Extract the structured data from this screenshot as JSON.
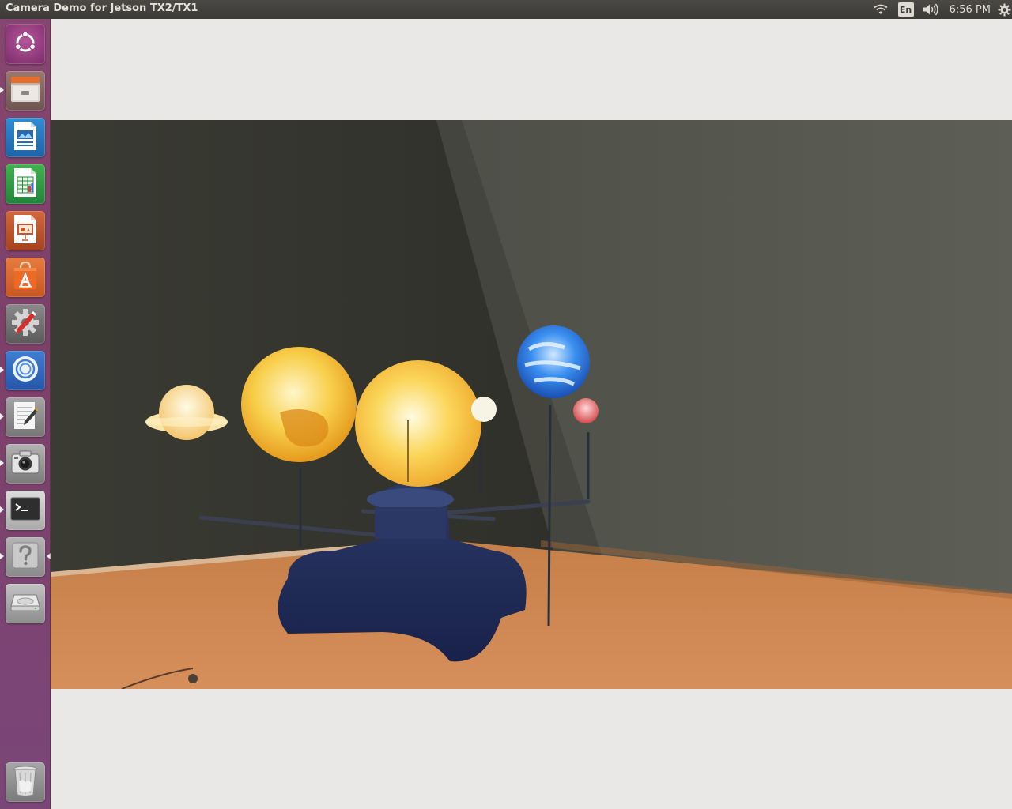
{
  "window": {
    "title": "Camera Demo for Jetson TX2/TX1"
  },
  "indicators": {
    "network_icon": "wifi-icon",
    "keyboard_layout": "En",
    "volume_icon": "speaker-icon",
    "clock": "6:56 PM",
    "system_icon": "gear-icon"
  },
  "launcher": {
    "items": [
      {
        "name": "ubuntu-dash",
        "icon": "ubuntu-logo-icon"
      },
      {
        "name": "files",
        "icon": "file-cabinet-icon"
      },
      {
        "name": "libreoffice-writer",
        "icon": "writer-document-icon"
      },
      {
        "name": "libreoffice-calc",
        "icon": "calc-spreadsheet-icon"
      },
      {
        "name": "libreoffice-impress",
        "icon": "impress-presentation-icon"
      },
      {
        "name": "ubuntu-software",
        "icon": "shopping-bag-icon"
      },
      {
        "name": "system-settings",
        "icon": "settings-wrench-icon"
      },
      {
        "name": "chromium",
        "icon": "chromium-icon"
      },
      {
        "name": "text-editor",
        "icon": "text-editor-icon"
      },
      {
        "name": "camera-demo",
        "icon": "camera-icon"
      },
      {
        "name": "terminal",
        "icon": "terminal-icon"
      },
      {
        "name": "help",
        "icon": "help-icon"
      },
      {
        "name": "drive",
        "icon": "hard-drive-icon"
      },
      {
        "name": "trash",
        "icon": "trash-icon"
      }
    ]
  },
  "camera_view": {
    "content": "live-camera-feed"
  }
}
